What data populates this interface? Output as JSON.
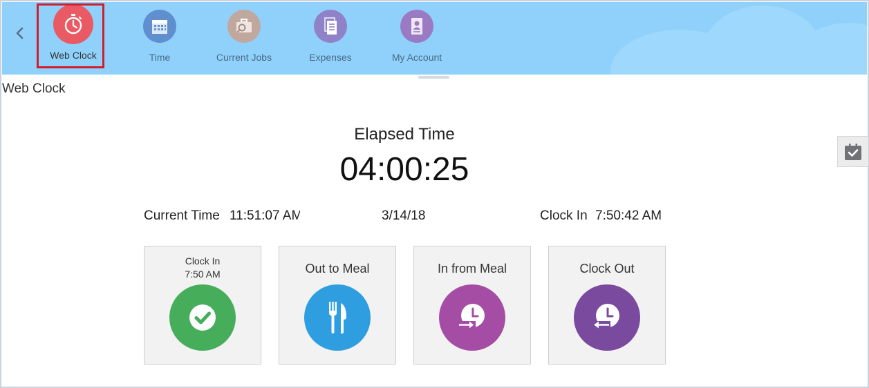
{
  "colors": {
    "navbar_bg": "#8fd1fb",
    "active_outline": "#d21b2b",
    "web_clock": "#ea5a64",
    "time": "#5f8fcf",
    "current_jobs": "#c0a89e",
    "expenses": "#8f82c9",
    "my_account": "#9a7bc3",
    "clock_in": "#46ad5b",
    "out_to_meal": "#2f9ee0",
    "in_from_meal": "#a54da5",
    "clock_out": "#7a4a9f"
  },
  "nav": {
    "items": [
      {
        "label": "Web Clock",
        "icon": "stopwatch-icon",
        "active": true
      },
      {
        "label": "Time",
        "icon": "calendar-icon"
      },
      {
        "label": "Current Jobs",
        "icon": "briefcase-search-icon"
      },
      {
        "label": "Expenses",
        "icon": "documents-icon"
      },
      {
        "label": "My Account",
        "icon": "id-badge-icon"
      }
    ]
  },
  "page": {
    "title": "Web Clock"
  },
  "clock": {
    "elapsed_label": "Elapsed Time",
    "elapsed_value": "04:00:25",
    "current_time_label": "Current Time",
    "current_time_value": "11:51:07 AM",
    "date": "3/14/18",
    "clock_in_label": "Clock In",
    "clock_in_value": "7:50:42 AM"
  },
  "tiles": [
    {
      "label": "Clock In",
      "sublabel": "7:50 AM",
      "icon": "checkmark-icon"
    },
    {
      "label": "Out to Meal",
      "icon": "fork-knife-icon"
    },
    {
      "label": "In from Meal",
      "icon": "clock-arrow-in-icon"
    },
    {
      "label": "Clock Out",
      "icon": "clock-arrow-out-icon"
    }
  ]
}
